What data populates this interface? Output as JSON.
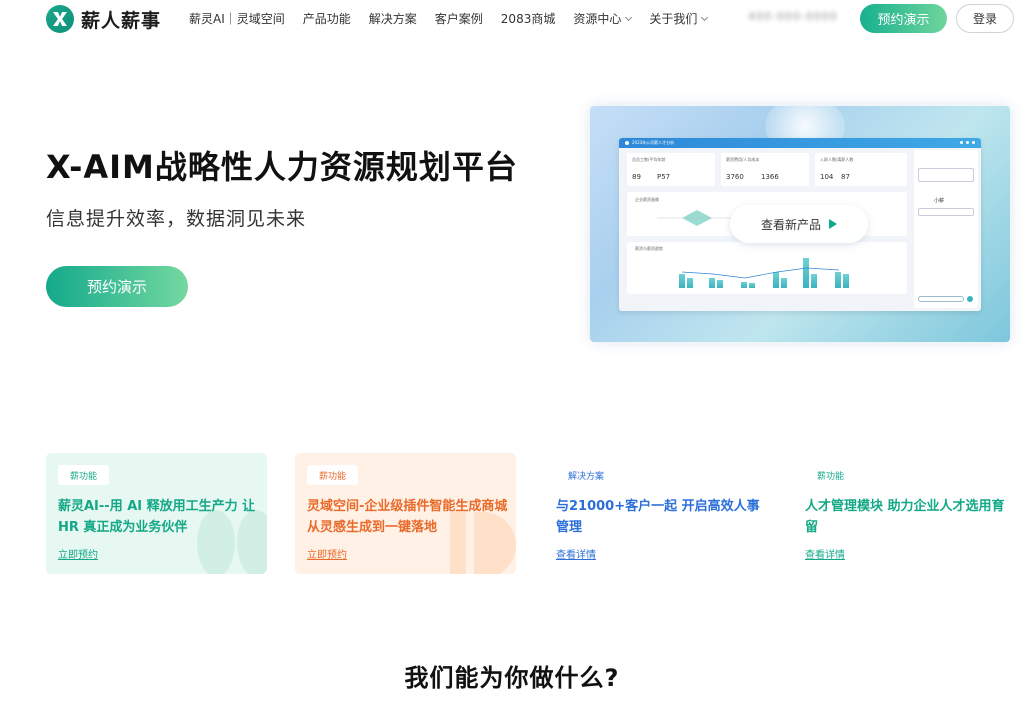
{
  "brand": {
    "name": "薪人薪事"
  },
  "nav": {
    "items": [
      {
        "label": "薪灵AI｜灵域空间"
      },
      {
        "label": "产品功能"
      },
      {
        "label": "解决方案"
      },
      {
        "label": "客户案例"
      },
      {
        "label": "2083商城"
      },
      {
        "label": "资源中心"
      },
      {
        "label": "关于我们"
      }
    ],
    "phone": "400-000-0000",
    "demo_label": "预约演示",
    "login_label": "登录"
  },
  "hero": {
    "title": "X-AIM战略性人力资源规划平台",
    "subtitle": "信息提升效率，数据洞见未来",
    "cta_label": "预约演示"
  },
  "mock": {
    "window_title": "2023年公司薪人才分析",
    "stat1_label": "总员工数/平均年龄",
    "stat1_value": "89",
    "stat1_value2": "P57",
    "stat2_label": "薪资费用/人均成本",
    "stat2_value": "3760",
    "stat2_value2": "1366",
    "stat3_label": "入职人数/离职人数",
    "stat3_value": "104",
    "stat3_value2": "87",
    "chart1_label": "企业薪资画像",
    "chart2_label": "薪资与薪资趋势",
    "side_name": "小薪",
    "overlay_label": "查看新产品",
    "colors": {
      "accent": "#14a98b",
      "window_bar": "#2e88d8"
    }
  },
  "features": [
    {
      "badge": "薪功能",
      "title": "薪灵AI--用 AI 释放用工生产力 让 HR 真正成为业务伙伴",
      "link": "立即预约",
      "accent": "#13a887"
    },
    {
      "badge": "薪功能",
      "title": "灵域空间-企业级插件智能生成商城 从灵感生成到一键落地",
      "link": "立即预约",
      "accent": "#ea6a2a"
    },
    {
      "badge": "解决方案",
      "title": "与21000+客户一起 开启高效人事管理",
      "link": "查看详情",
      "accent": "#2c6fd8"
    },
    {
      "badge": "薪功能",
      "title": "人才管理模块 助力企业人才选用育留",
      "link": "查看详情",
      "accent": "#13a887"
    }
  ],
  "section": {
    "title": "我们能为你做什么?"
  }
}
